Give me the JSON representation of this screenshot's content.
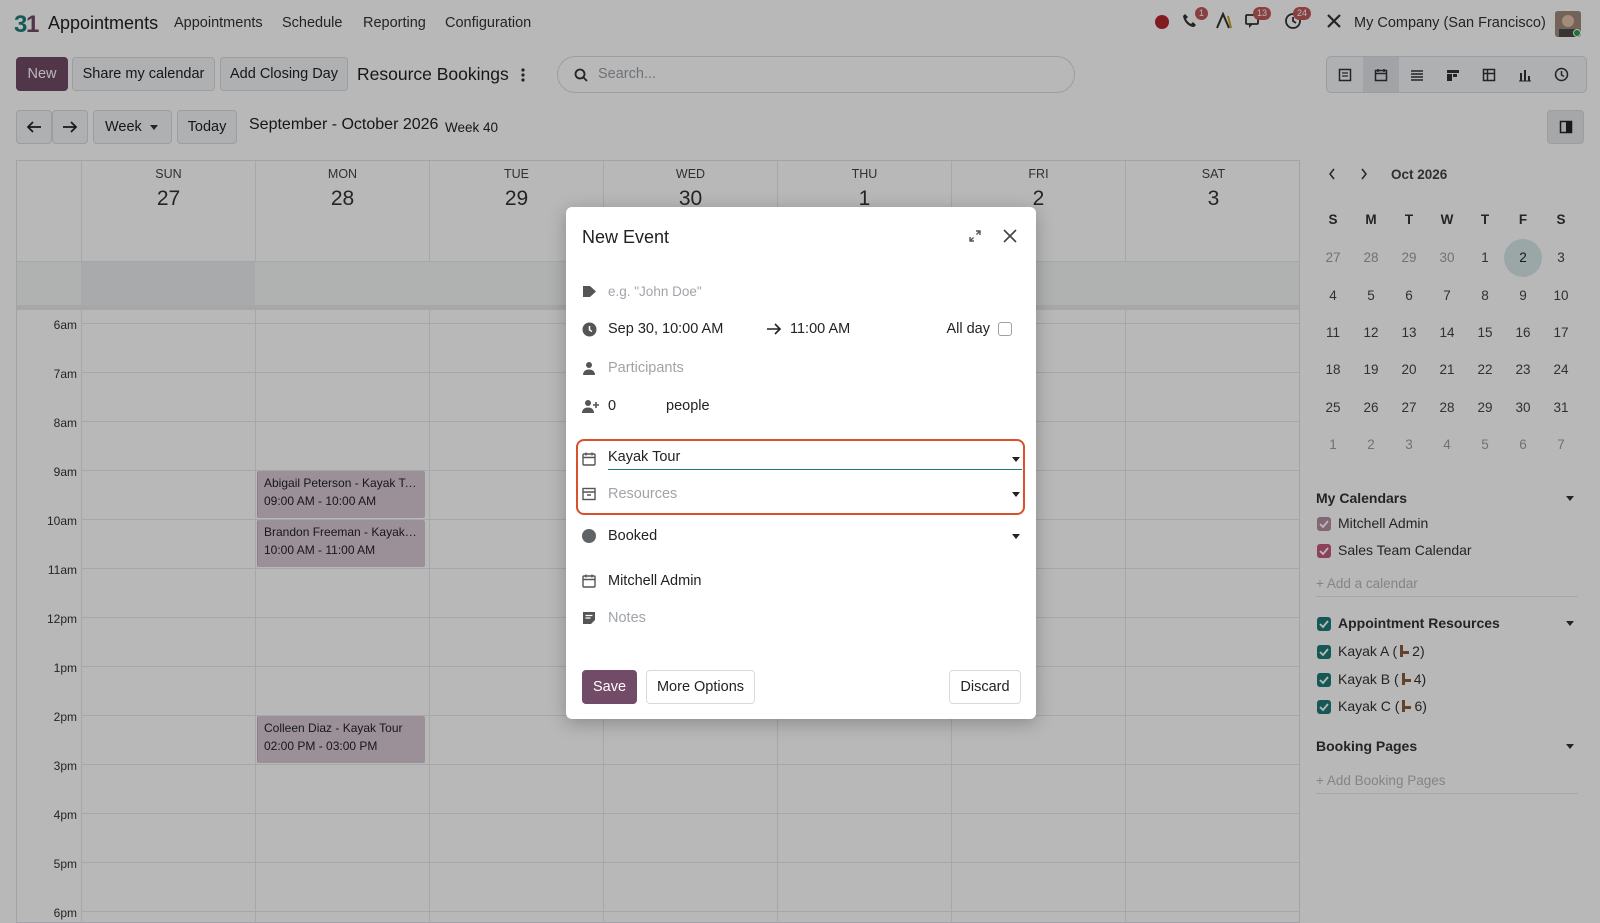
{
  "navbar": {
    "app_name": "Appointments",
    "menus": [
      "Appointments",
      "Schedule",
      "Reporting",
      "Configuration"
    ],
    "badges": {
      "phone": "1",
      "messages": "13",
      "activities": "24"
    },
    "company": "My Company (San Francisco)"
  },
  "control": {
    "new_label": "New",
    "share_label": "Share my calendar",
    "closing_label": "Add Closing Day",
    "breadcrumb": "Resource Bookings",
    "search_placeholder": "Search..."
  },
  "toolbar": {
    "scale": "Week",
    "today_label": "Today",
    "range_label": "September - October 2026",
    "week_label": "Week 40"
  },
  "calendar": {
    "days": [
      {
        "name": "SUN",
        "num": "27"
      },
      {
        "name": "MON",
        "num": "28"
      },
      {
        "name": "TUE",
        "num": "29"
      },
      {
        "name": "WED",
        "num": "30"
      },
      {
        "name": "THU",
        "num": "1"
      },
      {
        "name": "FRI",
        "num": "2"
      },
      {
        "name": "SAT",
        "num": "3"
      }
    ],
    "hours": [
      "6am",
      "7am",
      "8am",
      "9am",
      "10am",
      "11am",
      "12pm",
      "1pm",
      "2pm",
      "3pm",
      "4pm",
      "5pm",
      "6pm"
    ],
    "events": [
      {
        "title": "Abigail Peterson - Kayak Tour",
        "time": "09:00 AM - 10:00 AM"
      },
      {
        "title": "Brandon Freeman - Kayak Tour",
        "time": "10:00 AM - 11:00 AM"
      },
      {
        "title": "Colleen Diaz - Kayak Tour",
        "time": "02:00 PM - 03:00 PM"
      }
    ]
  },
  "modal": {
    "title": "New Event",
    "name_placeholder": "e.g. \"John Doe\"",
    "start": "Sep 30, 10:00 AM",
    "end": "11:00 AM",
    "allday_label": "All day",
    "participants_placeholder": "Participants",
    "capacity": "0",
    "capacity_unit": "people",
    "appointment_type": "Kayak Tour",
    "resources_placeholder": "Resources",
    "status": "Booked",
    "organizer": "Mitchell Admin",
    "notes_placeholder": "Notes",
    "save_label": "Save",
    "more_label": "More Options",
    "discard_label": "Discard",
    "status_color": "#5f6368",
    "highlight_color": "#d9502b"
  },
  "sidebar": {
    "month_label": "Oct 2026",
    "weekdays": [
      "S",
      "M",
      "T",
      "W",
      "T",
      "F",
      "S"
    ],
    "weeks": [
      [
        "27",
        "28",
        "29",
        "30",
        "1",
        "2",
        "3"
      ],
      [
        "4",
        "5",
        "6",
        "7",
        "8",
        "9",
        "10"
      ],
      [
        "11",
        "12",
        "13",
        "14",
        "15",
        "16",
        "17"
      ],
      [
        "18",
        "19",
        "20",
        "21",
        "22",
        "23",
        "24"
      ],
      [
        "25",
        "26",
        "27",
        "28",
        "29",
        "30",
        "31"
      ],
      [
        "1",
        "2",
        "3",
        "4",
        "5",
        "6",
        "7"
      ]
    ],
    "my_calendars": {
      "title": "My Calendars",
      "items": [
        {
          "label": "Mitchell Admin",
          "color": "#b78ca4"
        },
        {
          "label": "Sales Team Calendar",
          "color": "#c25a7c"
        }
      ],
      "add_label": "+ Add a calendar"
    },
    "resources": {
      "title": "Appointment Resources",
      "items": [
        {
          "label": "Kayak A (",
          "count": "2)"
        },
        {
          "label": "Kayak B (",
          "count": "4)"
        },
        {
          "label": "Kayak C (",
          "count": "6)"
        }
      ],
      "color": "#1f7a77"
    },
    "booking": {
      "title": "Booking Pages",
      "add_label": "+ Add Booking Pages"
    }
  }
}
